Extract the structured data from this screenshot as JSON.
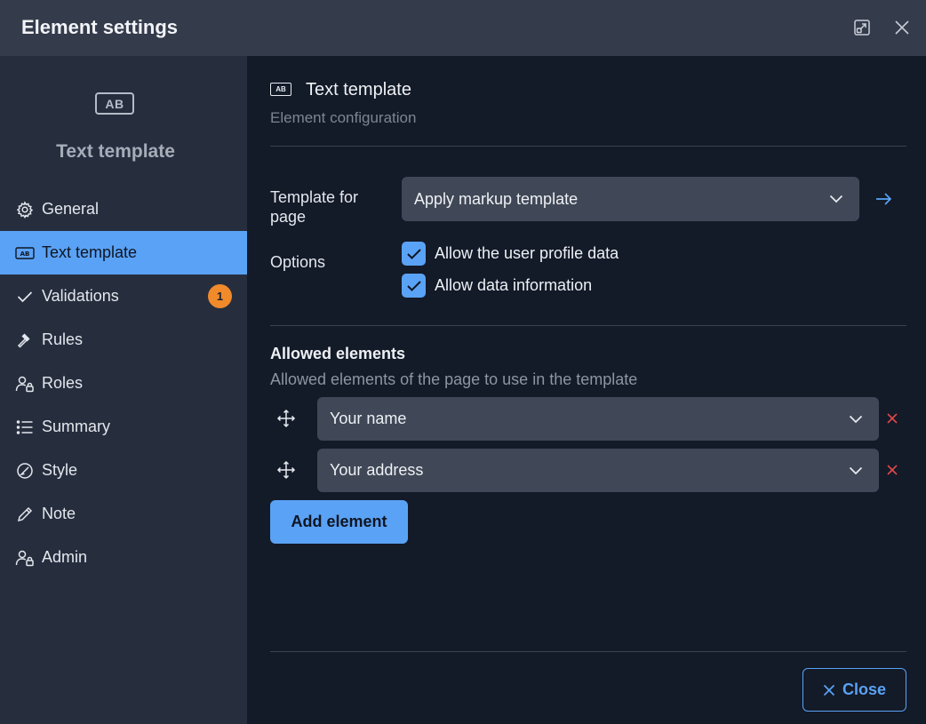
{
  "window": {
    "title": "Element settings",
    "expand_icon": "expand-icon",
    "close_icon": "close-icon"
  },
  "sidebar": {
    "header_icon_text": "AB",
    "header_title": "Text template",
    "items": [
      {
        "label": "General",
        "icon": "gear-icon"
      },
      {
        "label": "Text template",
        "icon": "text-template-icon",
        "active": true
      },
      {
        "label": "Validations",
        "icon": "check-icon",
        "badge": "1"
      },
      {
        "label": "Rules",
        "icon": "gavel-icon"
      },
      {
        "label": "Roles",
        "icon": "user-lock-icon"
      },
      {
        "label": "Summary",
        "icon": "list-icon"
      },
      {
        "label": "Style",
        "icon": "palette-icon"
      },
      {
        "label": "Note",
        "icon": "pencil-icon"
      },
      {
        "label": "Admin",
        "icon": "user-lock-icon"
      }
    ]
  },
  "main": {
    "header_icon_text": "AB",
    "title": "Text template",
    "subtitle": "Element configuration",
    "template_label": "Template for page",
    "template_value": "Apply markup template",
    "options_label": "Options",
    "options": [
      {
        "label": "Allow the user profile data",
        "checked": true
      },
      {
        "label": "Allow data information",
        "checked": true
      }
    ],
    "allowed_title": "Allowed elements",
    "allowed_subtitle": "Allowed elements of the page to use in the template",
    "allowed_items": [
      {
        "value": "Your name"
      },
      {
        "value": "Your address"
      }
    ],
    "add_button": "Add element",
    "close_button": "Close"
  },
  "colors": {
    "accent": "#5aa2f5",
    "badge": "#f08a2b",
    "delete": "#e04848"
  }
}
